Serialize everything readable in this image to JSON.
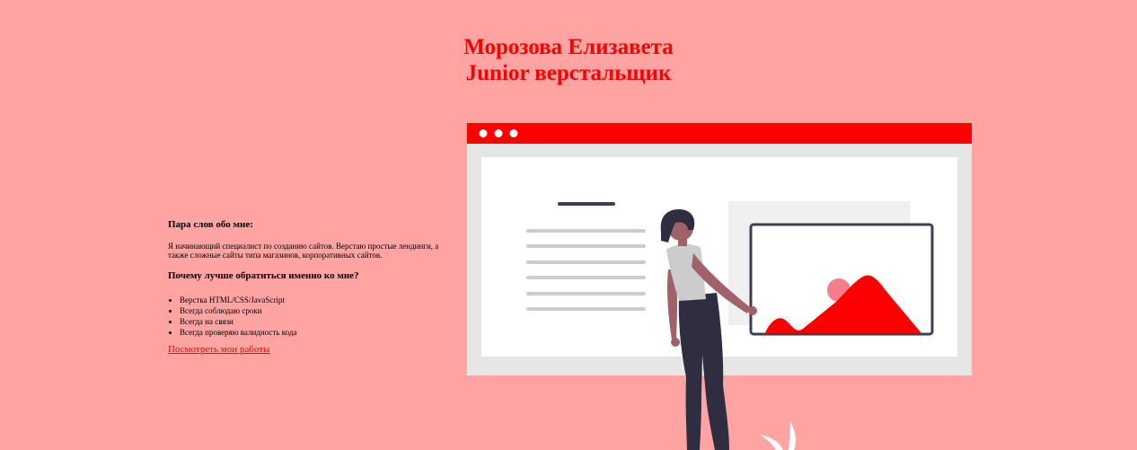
{
  "header": {
    "name": "Морозова Елизавета",
    "role": "Junior верстальщик"
  },
  "about": {
    "heading": "Пара слов обо мне:",
    "text": "Я начинающий специалист по созданию сайтов. Верстаю простые лендинги, а также сложные сайты типа магазинов, корпоративных сайтов.",
    "why_heading": "Почему лучше обратиться именно ко мне?",
    "reasons": [
      "Верстка HTML/CSS/JavaScript",
      "Всегда соблюдаю сроки",
      "Всегда на связи",
      "Всегда проверяю валидность кода"
    ],
    "portfolio_link": "Посмотреть мои работы"
  },
  "colors": {
    "background": "#ffa3a3",
    "accent": "#ff0000",
    "dark": "#2f2e41"
  },
  "illustration": {
    "icon": "web-designer-illustration"
  }
}
